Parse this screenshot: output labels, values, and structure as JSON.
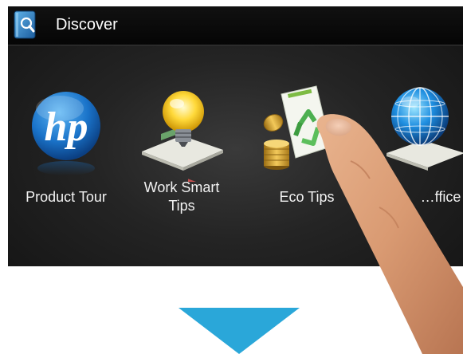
{
  "titlebar": {
    "title": "Discover",
    "icon": "discover-book-icon"
  },
  "tiles": [
    {
      "label": "Product Tour",
      "icon": "hp-logo-icon"
    },
    {
      "label": "Work Smart\nTips",
      "icon": "lightbulb-icon"
    },
    {
      "label": "Eco Tips",
      "icon": "eco-recycle-icon"
    },
    {
      "label": "…ffice",
      "icon": "globe-icon"
    }
  ],
  "overlay": {
    "hand": "pointing-finger",
    "arrow": "down-arrow-icon",
    "arrow_color": "#2aa7d9"
  },
  "colors": {
    "screen_bg": "#1c1c1c",
    "hp_blue": "#1d7fd1",
    "text": "#ffffff"
  }
}
